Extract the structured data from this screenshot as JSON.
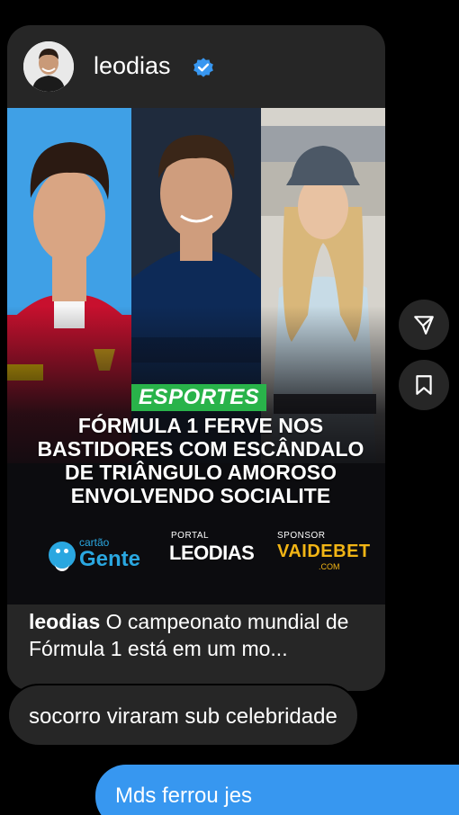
{
  "post": {
    "username": "leodias",
    "verified": true,
    "image": {
      "category": "ESPORTES",
      "headline": "FÓRMULA 1 FERVE NOS\nBASTIDORES COM ESCÂNDALO\nDE TRIÂNGULO AMOROSO\nENVOLVENDO SOCIALITE",
      "logos": {
        "gente_small": "cartão",
        "gente_big": "Gente",
        "portal_small": "PORTAL",
        "portal_big": "LEODIAS",
        "sponsor_small": "SPONSOR",
        "sponsor_big": "VAIDEBET",
        "sponsor_com": ".COM"
      }
    },
    "caption": {
      "user": "leodias",
      "text": " O campeonato mundial de Fórmula 1 está em um mo..."
    }
  },
  "actions": {
    "share_icon": "send-icon",
    "save_icon": "bookmark-icon"
  },
  "messages": [
    {
      "text": "socorro viraram sub celebridade"
    },
    {
      "text": "Mds ferrou jes"
    }
  ],
  "colors": {
    "bubble_received": "#262626",
    "bubble_sent": "#3797f0",
    "verified": "#3897f0",
    "category_tag": "#29b34a",
    "sponsor": "#f2b515"
  }
}
